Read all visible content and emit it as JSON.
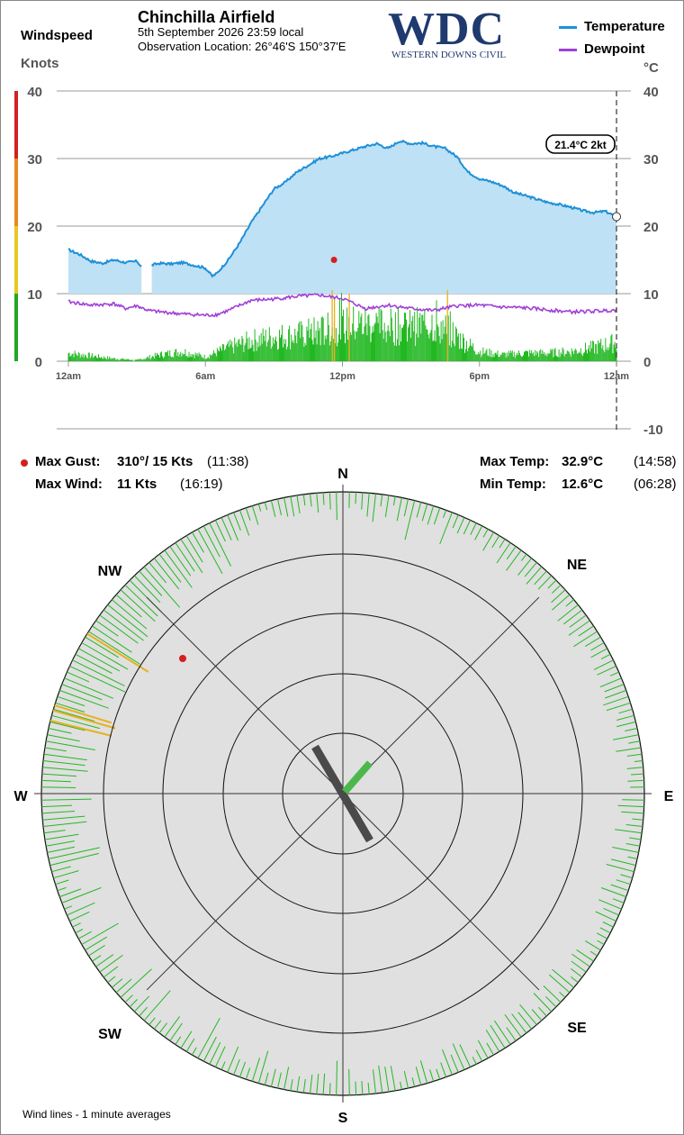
{
  "header": {
    "windspeed_label": "Windspeed",
    "knots_label": "Knots",
    "celsius_label": "°C",
    "station_name": "Chinchilla Airfield",
    "date_line": "5th September 2026  23:59 local",
    "location_line": "Observation Location:  26°46'S 150°37'E",
    "logo_text": "WDC",
    "logo_subtext": "WESTERN DOWNS CIVIL"
  },
  "legend": [
    {
      "label": "Temperature",
      "color": "#1e90d8"
    },
    {
      "label": "Dewpoint",
      "color": "#a040d8"
    }
  ],
  "colors": {
    "temperature": "#1e90d8",
    "temp_fill": "#bfe1f5",
    "dewpoint": "#a040d8",
    "wind_bars": "#22b822",
    "gust_bars": "#e8b020",
    "max_gust_marker": "#d42020",
    "rose_background": "#e0e0e0",
    "vector_dark": "#4a4a4a",
    "vector_green": "#4cb84c",
    "scale_red": "#d42020",
    "scale_orange": "#e88a20",
    "scale_yellow": "#e8c820",
    "scale_green": "#22a822"
  },
  "readout": "21.4°C  2kt",
  "stats": {
    "max_gust_label": "Max Gust:",
    "max_gust_value": "310°/  15 Kts",
    "max_gust_time": "(11:38)",
    "max_wind_label": "Max Wind:",
    "max_wind_value": "11 Kts",
    "max_wind_time": "(16:19)",
    "max_temp_label": "Max Temp:",
    "max_temp_value": "32.9°C",
    "max_temp_time": "(14:58)",
    "min_temp_label": "Min Temp:",
    "min_temp_value": "12.6°C",
    "min_temp_time": "(06:28)"
  },
  "compass": {
    "n": "N",
    "ne": "NE",
    "e": "E",
    "se": "SE",
    "s": "S",
    "sw": "SW",
    "w": "W",
    "nw": "NW"
  },
  "footer_note": "Wind lines - 1 minute averages",
  "chart_data": [
    {
      "type": "line",
      "x_ticks": [
        "12am",
        "6am",
        "12pm",
        "6pm",
        "12am"
      ],
      "x_unit": "hours",
      "xlim": [
        0,
        24
      ],
      "left_axis": {
        "label": "Knots",
        "ylim": [
          0,
          40
        ],
        "ticks": [
          0,
          10,
          20,
          30,
          40
        ]
      },
      "right_axis": {
        "label": "°C",
        "ylim": [
          -10,
          40
        ],
        "ticks": [
          -10,
          0,
          10,
          20,
          30,
          40
        ]
      },
      "grid": true,
      "series": [
        {
          "name": "Temperature",
          "axis": "right",
          "x": [
            0,
            0.5,
            1,
            1.5,
            2,
            2.5,
            3,
            3.2,
            3.5,
            3.6,
            4,
            4.5,
            5,
            5.5,
            6,
            6.3,
            6.5,
            7,
            7.5,
            8,
            8.5,
            9,
            9.5,
            10,
            10.5,
            11,
            11.5,
            12,
            12.5,
            13,
            13.5,
            14,
            14.5,
            15,
            15.5,
            16,
            16.5,
            17,
            17.5,
            18,
            18.5,
            19,
            19.5,
            20,
            20.5,
            21,
            21.5,
            22,
            22.5,
            23,
            23.5,
            24
          ],
          "y": [
            16.5,
            15.8,
            14.8,
            14.5,
            15,
            14.6,
            14.8,
            14,
            null,
            14.2,
            14.5,
            14.4,
            14.6,
            14.2,
            13.8,
            12.6,
            13,
            15,
            17.5,
            20.5,
            23,
            25.5,
            26.5,
            28,
            29,
            30,
            30.3,
            30.8,
            31.3,
            31.8,
            32.2,
            31.5,
            32.6,
            32.2,
            32.3,
            31.8,
            31.5,
            30.3,
            28,
            27,
            26.6,
            26,
            25,
            24.5,
            24,
            23.5,
            23.2,
            22.8,
            22.3,
            22,
            22.2,
            21.4
          ]
        },
        {
          "name": "Dewpoint",
          "axis": "right",
          "x": [
            0,
            1,
            2,
            2.5,
            3,
            3.5,
            4,
            5,
            6,
            6.5,
            7,
            8,
            9,
            10,
            11,
            11.5,
            12,
            13,
            14,
            15,
            16,
            17,
            18,
            19,
            20,
            21,
            22,
            23,
            24
          ],
          "y": [
            8.8,
            8.3,
            8.5,
            7.8,
            8.2,
            7.5,
            7.3,
            7,
            6.8,
            6.9,
            7.5,
            9,
            9.2,
            9.6,
            9.8,
            9.5,
            9.3,
            7.8,
            8.3,
            7.8,
            7.5,
            8.2,
            8.3,
            8,
            7.9,
            7.6,
            7.3,
            7.4,
            7.6
          ]
        },
        {
          "name": "Windspeed",
          "axis": "left",
          "kind": "bars",
          "x": [
            0,
            1,
            2,
            3,
            4,
            5,
            6,
            7,
            8,
            9,
            10,
            11,
            12,
            13,
            14,
            15,
            16,
            17,
            18,
            19,
            20,
            21,
            22,
            23,
            24
          ],
          "y": [
            1.5,
            1,
            0.5,
            0.2,
            1.2,
            1.8,
            0.8,
            2.5,
            3.8,
            4.5,
            4.8,
            5.5,
            6.5,
            7,
            6.5,
            6.2,
            7.2,
            4.5,
            1.8,
            1.2,
            1.5,
            1.5,
            1.8,
            2.5,
            3.5
          ]
        }
      ],
      "max_gust_point": {
        "x": 11.63,
        "y": 15
      }
    },
    {
      "type": "polar",
      "rings": 4,
      "resultant_vector_deg": 330,
      "average_vector_deg": 35
    }
  ]
}
